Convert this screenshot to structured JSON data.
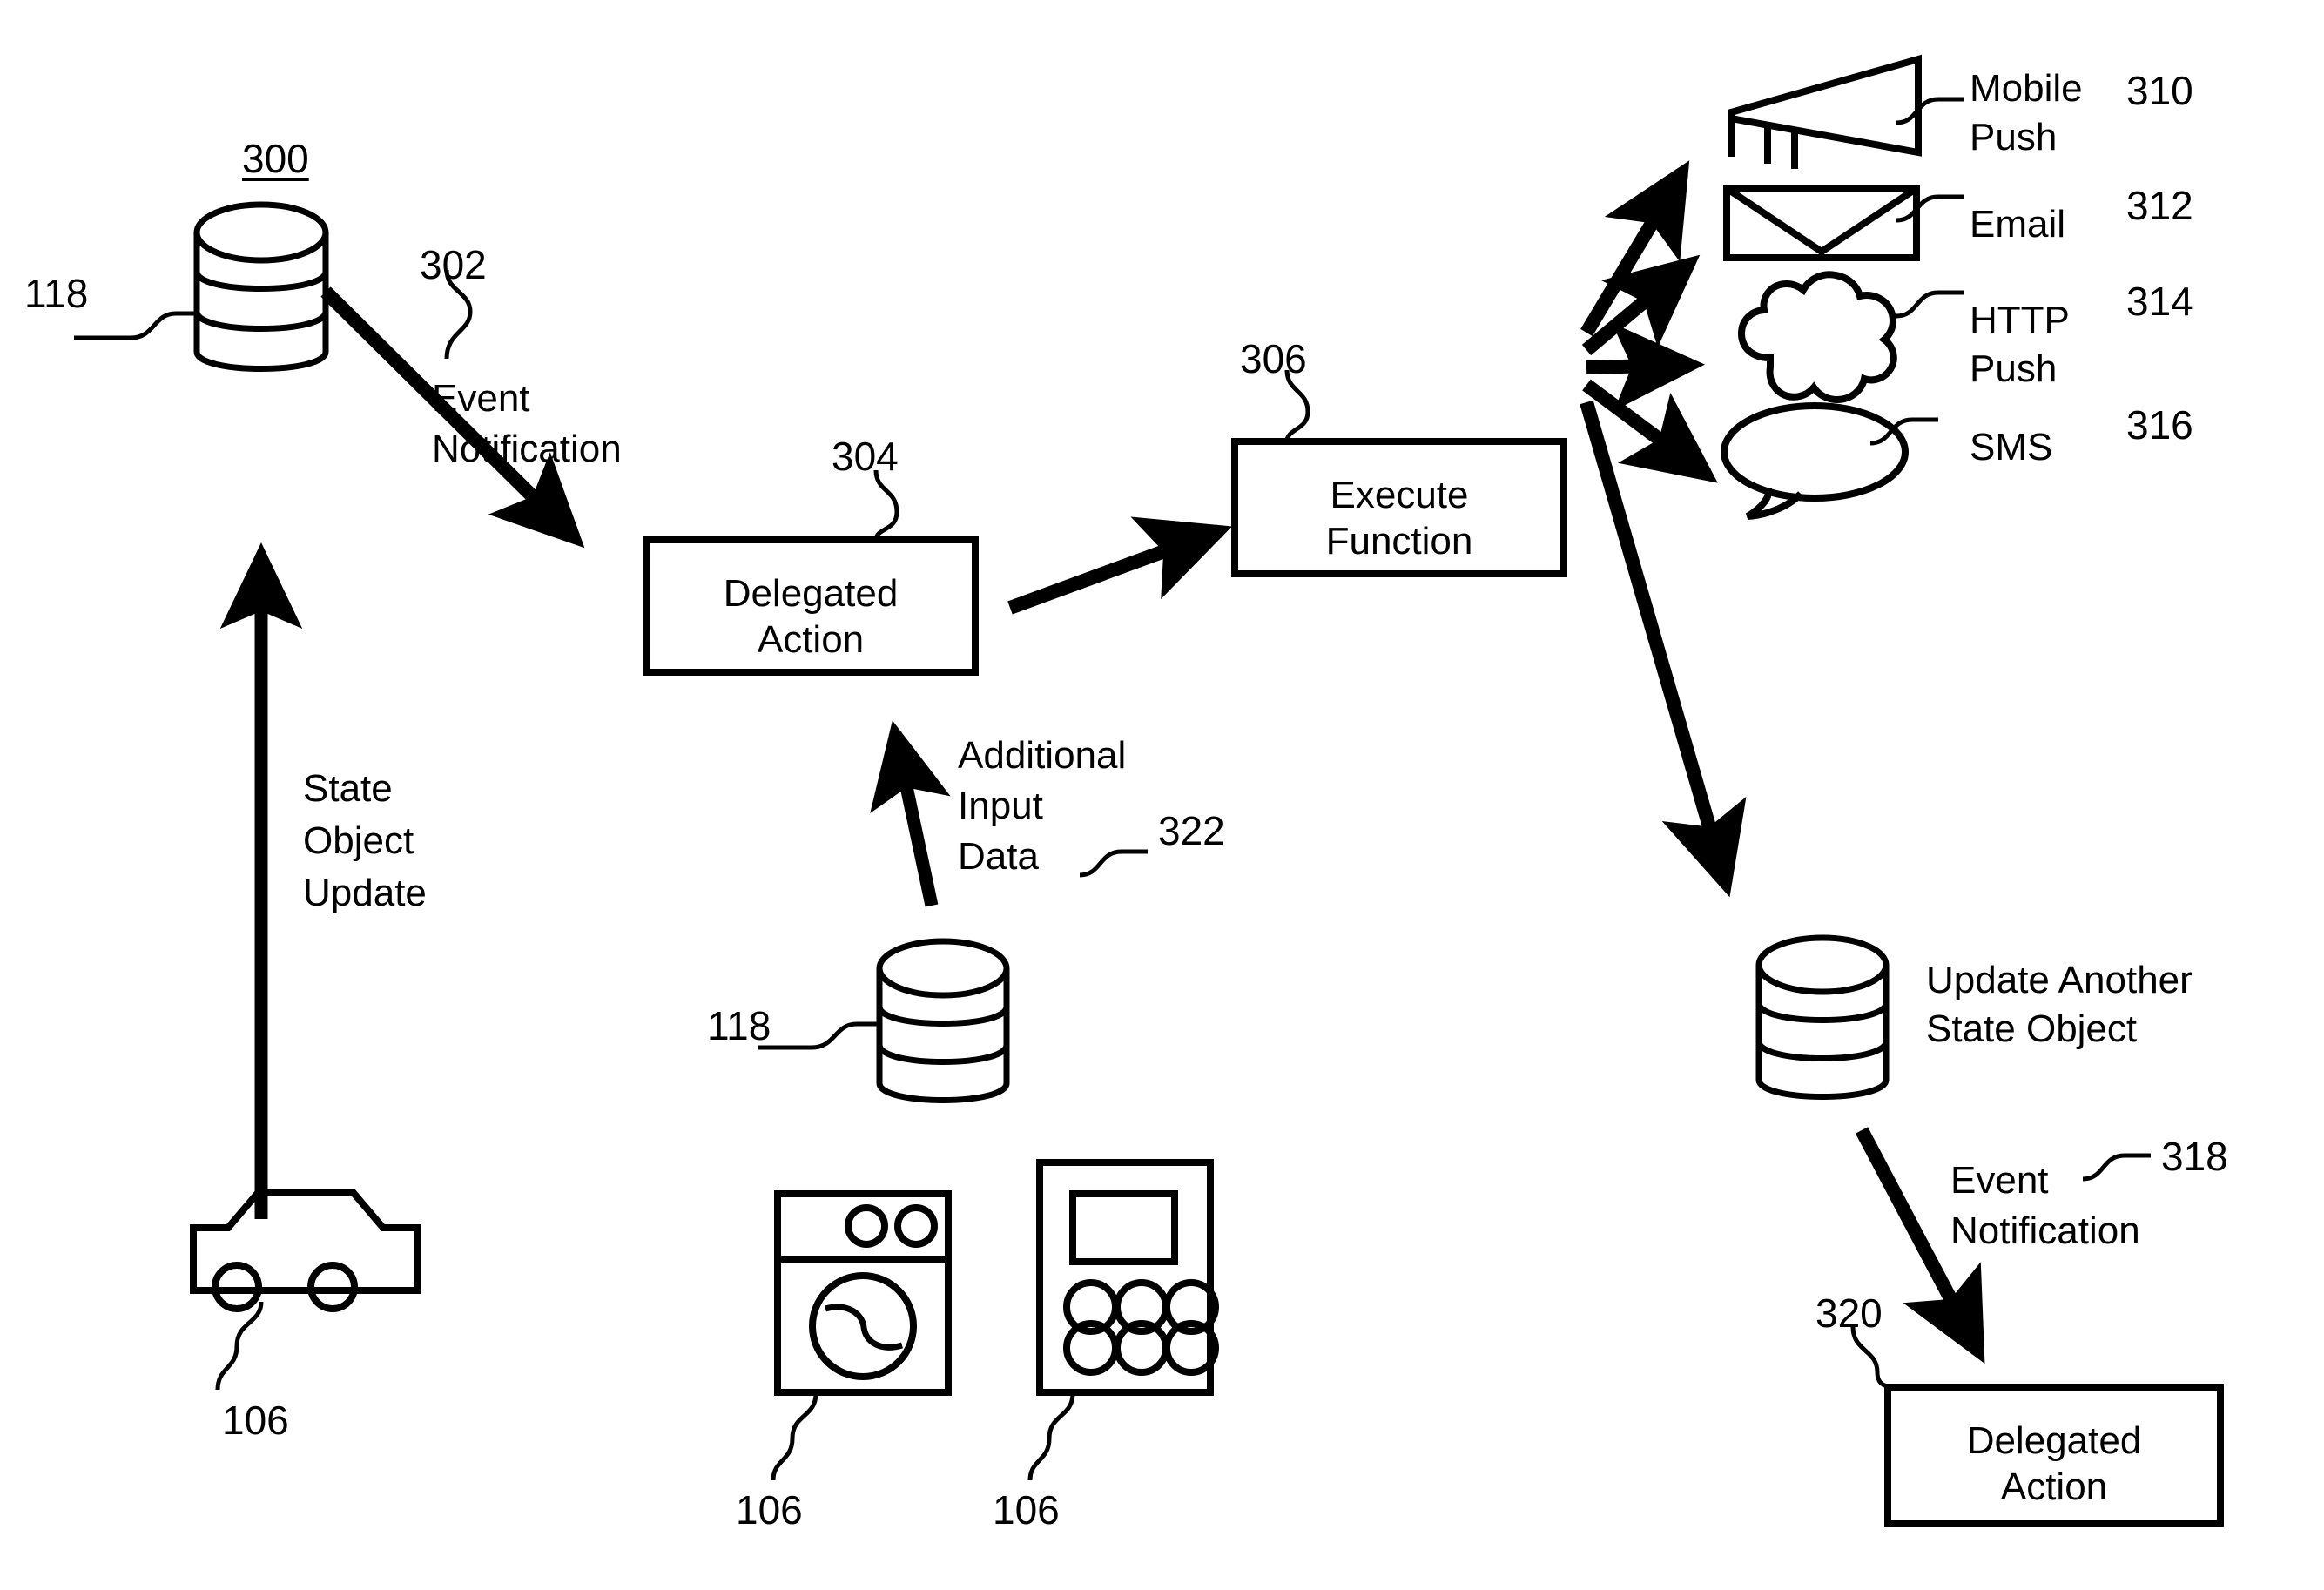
{
  "figure": {
    "number": "300",
    "type": "patent-flow-diagram"
  },
  "reference_numerals": {
    "figure": "300",
    "event_notification_1": "302",
    "delegated_action_1": "304",
    "execute_function": "306",
    "mobile_push": "310",
    "email": "312",
    "http_push": "314",
    "sms": "316",
    "event_notification_2": "318",
    "delegated_action_2": "320",
    "additional_input_data": "322",
    "state_object_store_1": "118",
    "state_object_store_2": "118",
    "device_car": "106",
    "device_washer": "106",
    "device_keypad": "106"
  },
  "nodes": {
    "state_object_db": {
      "icon": "database-cylinder-icon",
      "numeral": "118"
    },
    "delegated_action_1": {
      "line1": "Delegated",
      "line2": "Action",
      "numeral": "304"
    },
    "execute_function": {
      "line1": "Execute",
      "line2": "Function",
      "numeral": "306"
    },
    "additional_input_db": {
      "icon": "database-cylinder-icon",
      "numeral": "118"
    },
    "update_another_state_object_db": {
      "icon": "database-cylinder-icon",
      "line1": "Update Another",
      "line2": "State Object"
    },
    "delegated_action_2": {
      "line1": "Delegated",
      "line2": "Action",
      "numeral": "320"
    }
  },
  "edges": {
    "event_notification_1": {
      "line1": "Event",
      "line2": "Notification",
      "numeral": "302"
    },
    "state_object_update": {
      "line1": "State",
      "line2": "Object",
      "line3": "Update"
    },
    "additional_input_data": {
      "line1": "Additional",
      "line2": "Input",
      "line3": "Data",
      "numeral": "322"
    },
    "event_notification_2": {
      "line1": "Event",
      "line2": "Notification",
      "numeral": "318"
    }
  },
  "outputs": [
    {
      "id": "mobile-push",
      "icon": "megaphone-icon",
      "line1": "Mobile",
      "line2": "Push",
      "numeral": "310"
    },
    {
      "id": "email",
      "icon": "envelope-icon",
      "line1": "Email",
      "line2": "",
      "numeral": "312"
    },
    {
      "id": "http-push",
      "icon": "cloud-icon",
      "line1": "HTTP",
      "line2": "Push",
      "numeral": "314"
    },
    {
      "id": "sms",
      "icon": "speech-bubble-icon",
      "line1": "SMS",
      "line2": "",
      "numeral": "316"
    }
  ],
  "devices": [
    {
      "id": "car",
      "icon": "car-icon",
      "numeral": "106"
    },
    {
      "id": "washer",
      "icon": "washing-machine-icon",
      "numeral": "106"
    },
    {
      "id": "keypad",
      "icon": "keypad-device-icon",
      "numeral": "106"
    }
  ],
  "colors": {
    "stroke": "#000000",
    "background": "#ffffff"
  }
}
